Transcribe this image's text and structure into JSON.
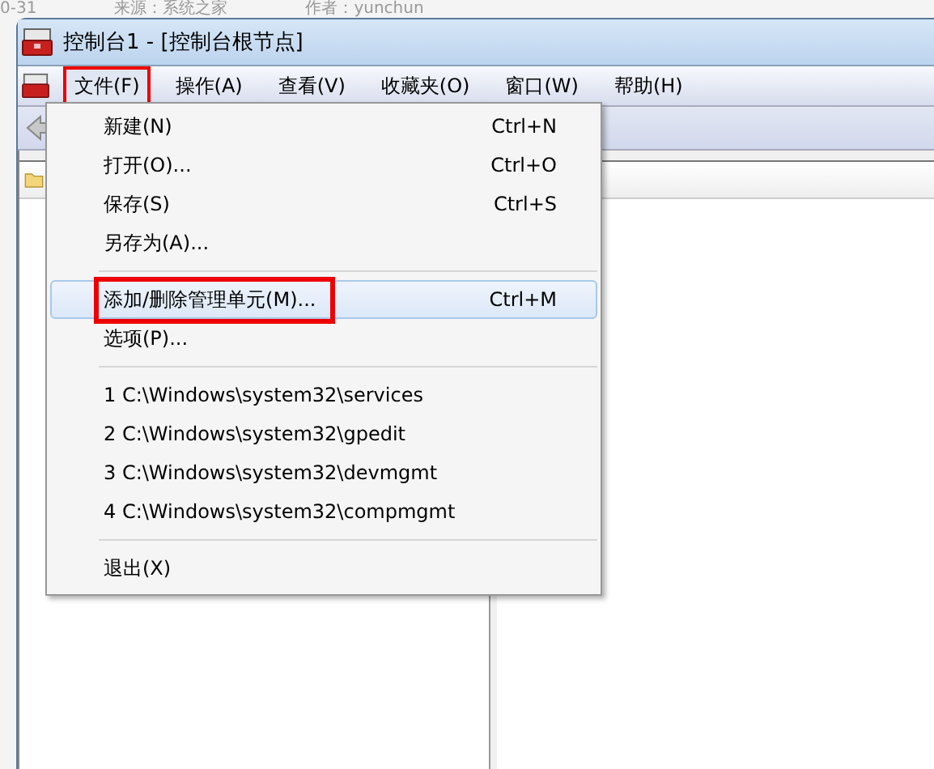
{
  "background_page": {
    "texts": [
      "0-31",
      "来源：系统之家",
      "作者：yunchun"
    ]
  },
  "window": {
    "title": "控制台1 - [控制台根节点]"
  },
  "menu_bar": [
    {
      "label": "文件(F)",
      "selected": true,
      "annotated": true
    },
    {
      "label": "操作(A)",
      "selected": false,
      "annotated": false
    },
    {
      "label": "查看(V)",
      "selected": false,
      "annotated": false
    },
    {
      "label": "收藏夹(O)",
      "selected": false,
      "annotated": false
    },
    {
      "label": "窗口(W)",
      "selected": false,
      "annotated": false
    },
    {
      "label": "帮助(H)",
      "selected": false,
      "annotated": false
    }
  ],
  "file_menu": [
    {
      "kind": "item",
      "label": "新建(N)",
      "shortcut": "Ctrl+N",
      "selected": false,
      "annotated": false
    },
    {
      "kind": "item",
      "label": "打开(O)...",
      "shortcut": "Ctrl+O",
      "selected": false,
      "annotated": false
    },
    {
      "kind": "item",
      "label": "保存(S)",
      "shortcut": "Ctrl+S",
      "selected": false,
      "annotated": false
    },
    {
      "kind": "item",
      "label": "另存为(A)...",
      "selected": false,
      "annotated": false
    },
    {
      "kind": "separator"
    },
    {
      "kind": "item",
      "label": "添加/删除管理单元(M)...",
      "shortcut": "Ctrl+M",
      "selected": true,
      "annotated": true
    },
    {
      "kind": "item",
      "label": "选项(P)...",
      "selected": false,
      "annotated": false
    },
    {
      "kind": "separator"
    },
    {
      "kind": "item",
      "label": "1 C:\\Windows\\system32\\services",
      "selected": false,
      "annotated": false
    },
    {
      "kind": "item",
      "label": "2 C:\\Windows\\system32\\gpedit",
      "selected": false,
      "annotated": false
    },
    {
      "kind": "item",
      "label": "3 C:\\Windows\\system32\\devmgmt",
      "selected": false,
      "annotated": false
    },
    {
      "kind": "item",
      "label": "4 C:\\Windows\\system32\\compmgmt",
      "selected": false,
      "annotated": false
    },
    {
      "kind": "separator"
    },
    {
      "kind": "item",
      "label": "退出(X)",
      "selected": false,
      "annotated": false
    }
  ]
}
